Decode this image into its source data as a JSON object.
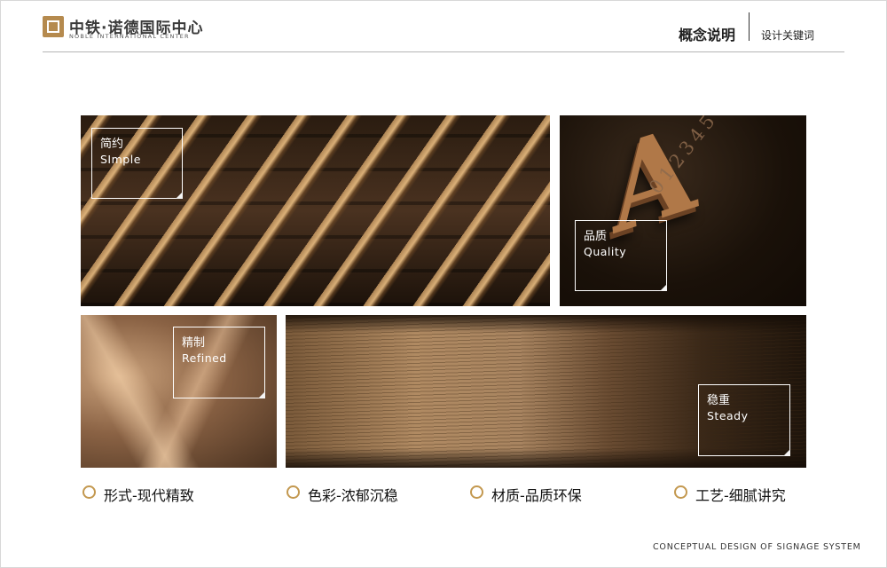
{
  "header": {
    "logo_cn": "中铁·诺德国际中心",
    "logo_en": "NOBLE INTERNATIONAL CENTER",
    "title": "概念说明",
    "subtitle": "设计关键词"
  },
  "panels": {
    "simple": {
      "cn": "简约",
      "en": "SImple"
    },
    "quality": {
      "cn": "品质",
      "en": "Quality",
      "letter": "A",
      "digits": "0123456789 AB"
    },
    "refined": {
      "cn": "精制",
      "en": "Refined"
    },
    "steady": {
      "cn": "稳重",
      "en": "Steady"
    }
  },
  "keywords": [
    "形式-现代精致",
    "色彩-浓郁沉稳",
    "材质-品质环保",
    "工艺-细腻讲究"
  ],
  "footer": "CONCEPTUAL DESIGN OF SIGNAGE SYSTEM",
  "colors": {
    "accent_gold": "#c3984f",
    "logo_gold": "#b58a4e",
    "rule": "#b5b5b5"
  }
}
